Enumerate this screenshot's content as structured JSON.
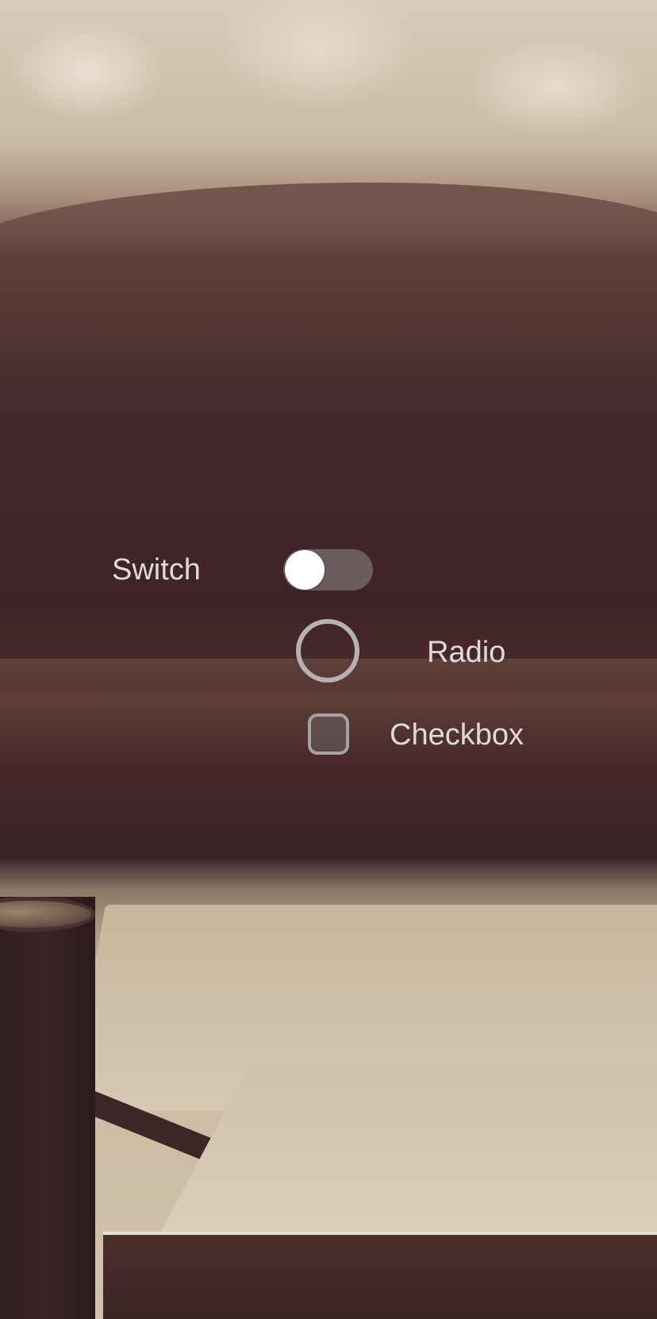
{
  "controls": {
    "switch": {
      "label": "Switch",
      "state": "off"
    },
    "radio": {
      "label": "Radio",
      "state": "unselected"
    },
    "checkbox": {
      "label": "Checkbox",
      "state": "unchecked"
    }
  },
  "colors": {
    "label_text": "#dedad8",
    "switch_track": "#787070",
    "switch_knob": "#ffffff",
    "control_border": "#b7b2b2"
  }
}
